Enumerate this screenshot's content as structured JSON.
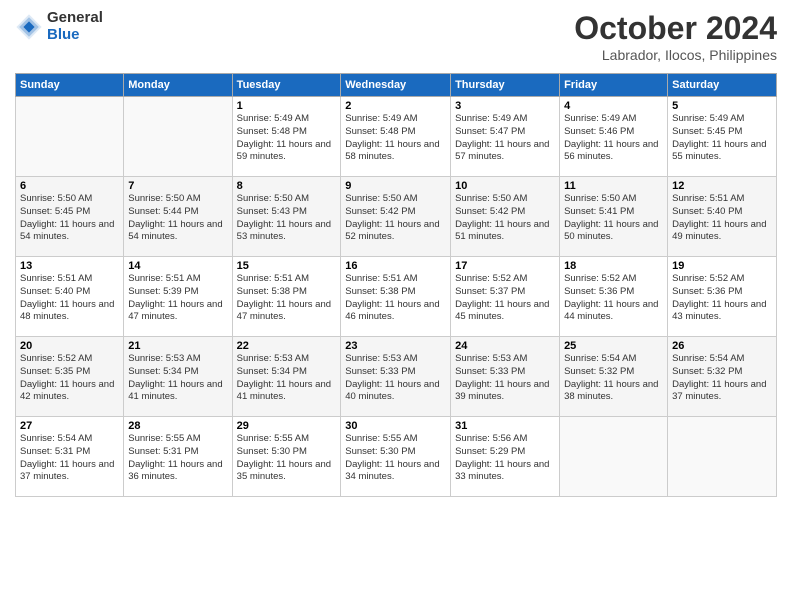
{
  "header": {
    "logo_general": "General",
    "logo_blue": "Blue",
    "month_title": "October 2024",
    "location": "Labrador, Ilocos, Philippines"
  },
  "weekdays": [
    "Sunday",
    "Monday",
    "Tuesday",
    "Wednesday",
    "Thursday",
    "Friday",
    "Saturday"
  ],
  "weeks": [
    [
      {
        "day": "",
        "info": ""
      },
      {
        "day": "",
        "info": ""
      },
      {
        "day": "1",
        "info": "Sunrise: 5:49 AM\nSunset: 5:48 PM\nDaylight: 11 hours and 59 minutes."
      },
      {
        "day": "2",
        "info": "Sunrise: 5:49 AM\nSunset: 5:48 PM\nDaylight: 11 hours and 58 minutes."
      },
      {
        "day": "3",
        "info": "Sunrise: 5:49 AM\nSunset: 5:47 PM\nDaylight: 11 hours and 57 minutes."
      },
      {
        "day": "4",
        "info": "Sunrise: 5:49 AM\nSunset: 5:46 PM\nDaylight: 11 hours and 56 minutes."
      },
      {
        "day": "5",
        "info": "Sunrise: 5:49 AM\nSunset: 5:45 PM\nDaylight: 11 hours and 55 minutes."
      }
    ],
    [
      {
        "day": "6",
        "info": "Sunrise: 5:50 AM\nSunset: 5:45 PM\nDaylight: 11 hours and 54 minutes."
      },
      {
        "day": "7",
        "info": "Sunrise: 5:50 AM\nSunset: 5:44 PM\nDaylight: 11 hours and 54 minutes."
      },
      {
        "day": "8",
        "info": "Sunrise: 5:50 AM\nSunset: 5:43 PM\nDaylight: 11 hours and 53 minutes."
      },
      {
        "day": "9",
        "info": "Sunrise: 5:50 AM\nSunset: 5:42 PM\nDaylight: 11 hours and 52 minutes."
      },
      {
        "day": "10",
        "info": "Sunrise: 5:50 AM\nSunset: 5:42 PM\nDaylight: 11 hours and 51 minutes."
      },
      {
        "day": "11",
        "info": "Sunrise: 5:50 AM\nSunset: 5:41 PM\nDaylight: 11 hours and 50 minutes."
      },
      {
        "day": "12",
        "info": "Sunrise: 5:51 AM\nSunset: 5:40 PM\nDaylight: 11 hours and 49 minutes."
      }
    ],
    [
      {
        "day": "13",
        "info": "Sunrise: 5:51 AM\nSunset: 5:40 PM\nDaylight: 11 hours and 48 minutes."
      },
      {
        "day": "14",
        "info": "Sunrise: 5:51 AM\nSunset: 5:39 PM\nDaylight: 11 hours and 47 minutes."
      },
      {
        "day": "15",
        "info": "Sunrise: 5:51 AM\nSunset: 5:38 PM\nDaylight: 11 hours and 47 minutes."
      },
      {
        "day": "16",
        "info": "Sunrise: 5:51 AM\nSunset: 5:38 PM\nDaylight: 11 hours and 46 minutes."
      },
      {
        "day": "17",
        "info": "Sunrise: 5:52 AM\nSunset: 5:37 PM\nDaylight: 11 hours and 45 minutes."
      },
      {
        "day": "18",
        "info": "Sunrise: 5:52 AM\nSunset: 5:36 PM\nDaylight: 11 hours and 44 minutes."
      },
      {
        "day": "19",
        "info": "Sunrise: 5:52 AM\nSunset: 5:36 PM\nDaylight: 11 hours and 43 minutes."
      }
    ],
    [
      {
        "day": "20",
        "info": "Sunrise: 5:52 AM\nSunset: 5:35 PM\nDaylight: 11 hours and 42 minutes."
      },
      {
        "day": "21",
        "info": "Sunrise: 5:53 AM\nSunset: 5:34 PM\nDaylight: 11 hours and 41 minutes."
      },
      {
        "day": "22",
        "info": "Sunrise: 5:53 AM\nSunset: 5:34 PM\nDaylight: 11 hours and 41 minutes."
      },
      {
        "day": "23",
        "info": "Sunrise: 5:53 AM\nSunset: 5:33 PM\nDaylight: 11 hours and 40 minutes."
      },
      {
        "day": "24",
        "info": "Sunrise: 5:53 AM\nSunset: 5:33 PM\nDaylight: 11 hours and 39 minutes."
      },
      {
        "day": "25",
        "info": "Sunrise: 5:54 AM\nSunset: 5:32 PM\nDaylight: 11 hours and 38 minutes."
      },
      {
        "day": "26",
        "info": "Sunrise: 5:54 AM\nSunset: 5:32 PM\nDaylight: 11 hours and 37 minutes."
      }
    ],
    [
      {
        "day": "27",
        "info": "Sunrise: 5:54 AM\nSunset: 5:31 PM\nDaylight: 11 hours and 37 minutes."
      },
      {
        "day": "28",
        "info": "Sunrise: 5:55 AM\nSunset: 5:31 PM\nDaylight: 11 hours and 36 minutes."
      },
      {
        "day": "29",
        "info": "Sunrise: 5:55 AM\nSunset: 5:30 PM\nDaylight: 11 hours and 35 minutes."
      },
      {
        "day": "30",
        "info": "Sunrise: 5:55 AM\nSunset: 5:30 PM\nDaylight: 11 hours and 34 minutes."
      },
      {
        "day": "31",
        "info": "Sunrise: 5:56 AM\nSunset: 5:29 PM\nDaylight: 11 hours and 33 minutes."
      },
      {
        "day": "",
        "info": ""
      },
      {
        "day": "",
        "info": ""
      }
    ]
  ]
}
